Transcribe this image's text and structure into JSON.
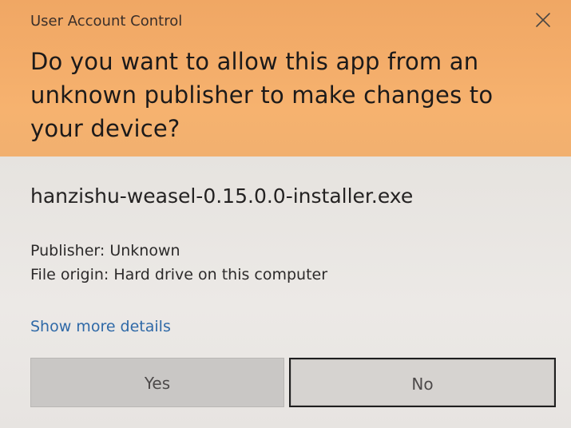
{
  "window": {
    "title": "User Account Control",
    "close_icon": "close-icon"
  },
  "prompt": {
    "question": "Do you want to allow this app from an unknown publisher to make changes to your device?"
  },
  "app": {
    "file_name": "hanzishu-weasel-0.15.0.0-installer.exe",
    "publisher": "Publisher: Unknown",
    "file_origin": "File origin: Hard drive on this computer",
    "details_link": "Show more details"
  },
  "buttons": {
    "yes": "Yes",
    "no": "No"
  },
  "colors": {
    "header": "#f3ac69",
    "body": "#ebe7e3",
    "link": "#2f69a7",
    "text": "#1c1a1a"
  }
}
